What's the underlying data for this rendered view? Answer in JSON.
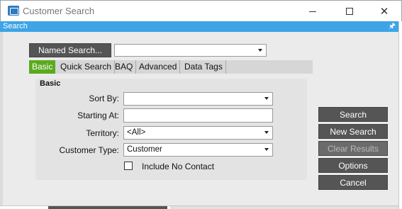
{
  "window": {
    "title": "Customer Search"
  },
  "panel": {
    "title": "Search"
  },
  "named_search": {
    "button_label": "Named Search...",
    "value": ""
  },
  "tabs": [
    {
      "label": "Basic",
      "active": true
    },
    {
      "label": "Quick Search",
      "active": false
    },
    {
      "label": "BAQ",
      "active": false
    },
    {
      "label": "Advanced",
      "active": false
    },
    {
      "label": "Data Tags",
      "active": false
    }
  ],
  "basic": {
    "group_title": "Basic",
    "sort_by": {
      "label": "Sort By:",
      "value": ""
    },
    "starting_at": {
      "label": "Starting At:",
      "value": ""
    },
    "territory": {
      "label": "Territory:",
      "value": "<All>"
    },
    "customer_type": {
      "label": "Customer Type:",
      "value": "Customer"
    },
    "include_no_contact": {
      "label": "Include No Contact",
      "checked": false
    }
  },
  "actions": {
    "search": "Search",
    "new_search": "New Search",
    "clear_results": "Clear Results",
    "options": "Options",
    "cancel": "Cancel"
  },
  "colors": {
    "panel_bar": "#3da4e6",
    "active_tab": "#5aaa1e",
    "button_dark": "#555555"
  }
}
